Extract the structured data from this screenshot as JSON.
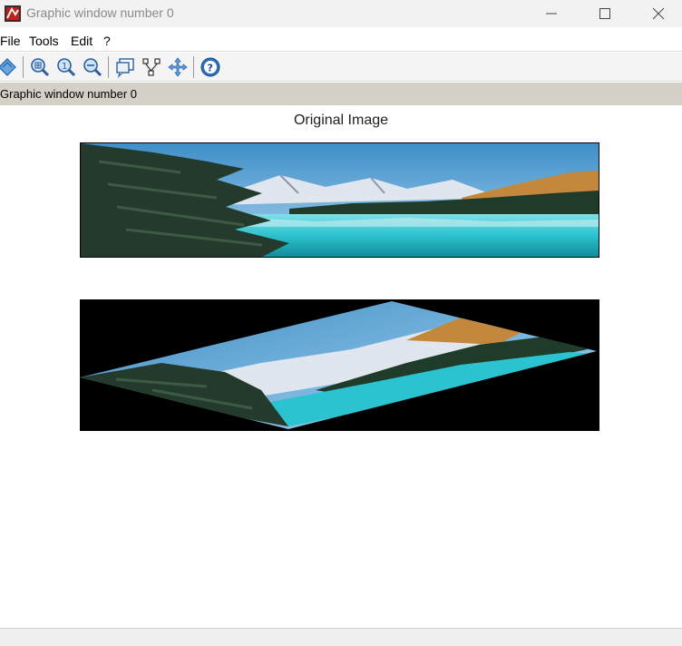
{
  "window": {
    "title": "Graphic window number 0",
    "app_icon": "scilab-graphic-icon",
    "controls": [
      "minimize-icon",
      "maximize-icon",
      "close-icon"
    ]
  },
  "menubar": {
    "items": [
      {
        "label": "File"
      },
      {
        "label": "Tools"
      },
      {
        "label": "Edit"
      },
      {
        "label": "?"
      }
    ]
  },
  "toolbar": {
    "icons": [
      "rotate-icon",
      "zoom-icon",
      "zoom-reset-icon",
      "zoom-out-icon",
      "datatip-icon",
      "graph-editor-icon",
      "pan-icon",
      "help-icon"
    ]
  },
  "infobar": {
    "text": "Graphic window number 0"
  },
  "figure": {
    "title": "Original Image",
    "images": [
      {
        "name": "original-landscape",
        "description_icon": "lake-landscape-image"
      },
      {
        "name": "sheared-landscape",
        "description_icon": "lake-landscape-image"
      }
    ]
  },
  "colors": {
    "sky": "#5aa8d6",
    "water": "#2cc4cf",
    "forest": "#1f3b2a",
    "snow": "#e8eef4",
    "hill": "#c8883a"
  }
}
